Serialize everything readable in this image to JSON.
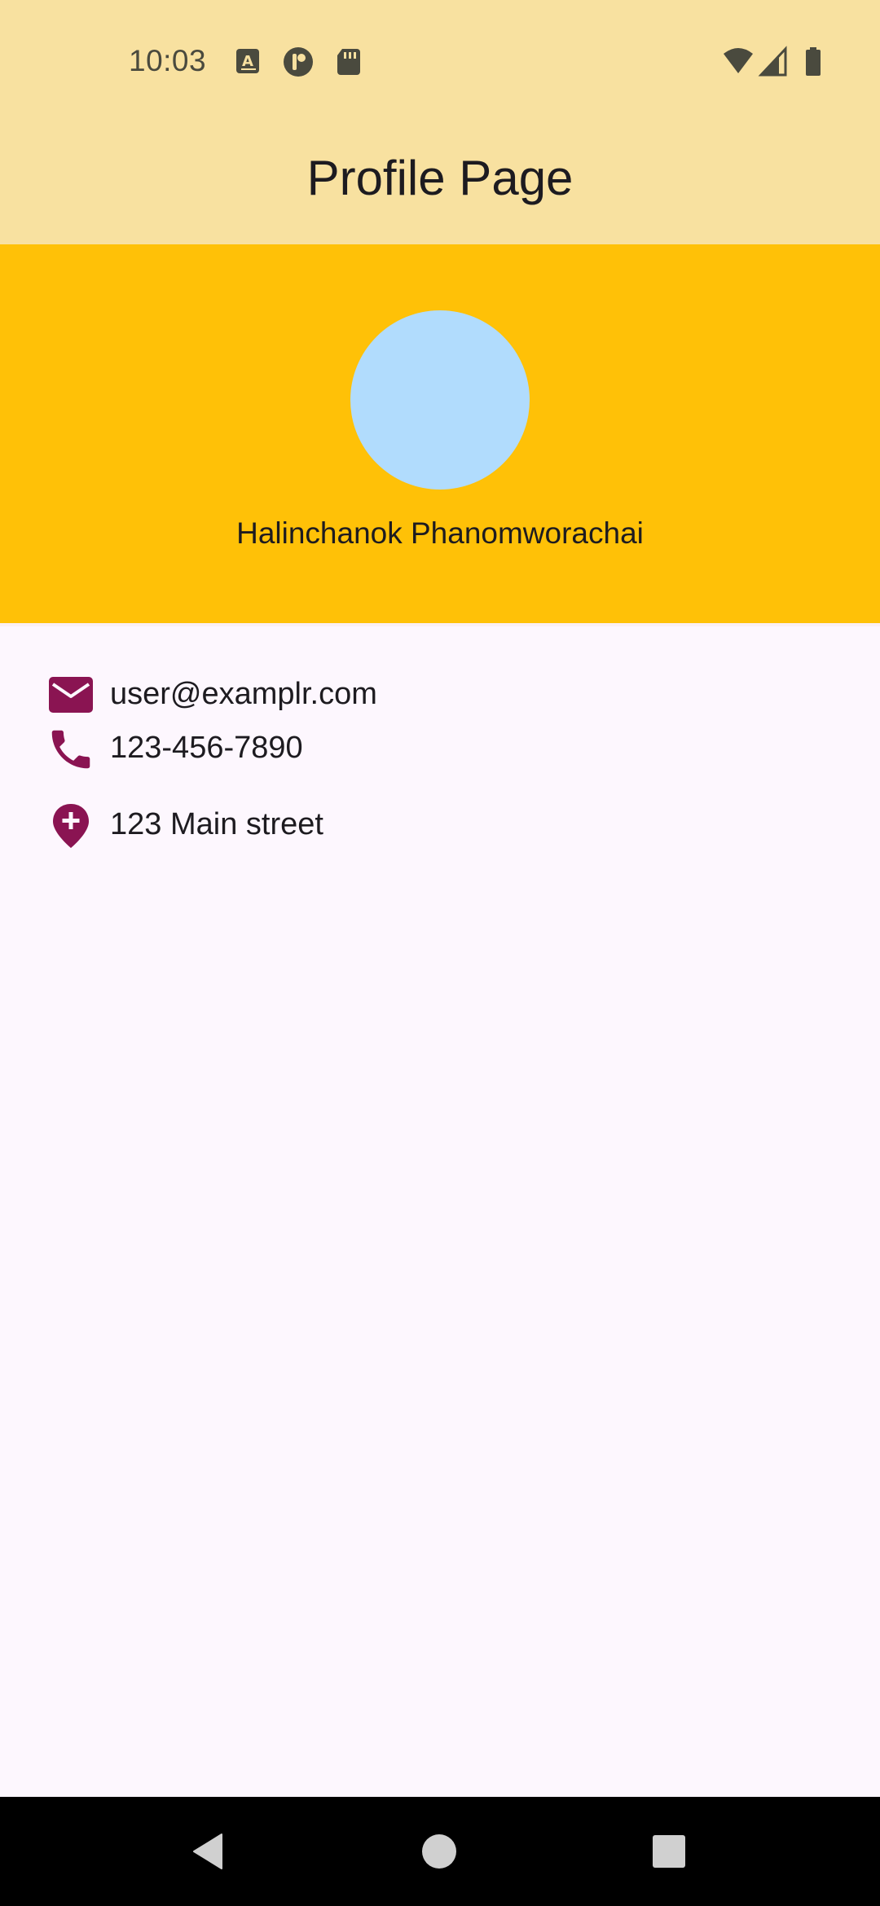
{
  "status_bar": {
    "time": "10:03"
  },
  "app_bar": {
    "title": "Profile Page"
  },
  "profile": {
    "name": "Halinchanok Phanomworachai"
  },
  "contact": {
    "email": "user@examplr.com",
    "phone": "123-456-7890",
    "address": "123 Main street"
  },
  "icons": {
    "email": "email-icon",
    "phone": "phone-icon",
    "address": "location-add-icon"
  },
  "colors": {
    "app_bar": "#F8E1A0",
    "header": "#FFC107",
    "avatar": "#B1DCFD",
    "icon_accent": "#8A1452",
    "background": "#FDF7FE"
  }
}
